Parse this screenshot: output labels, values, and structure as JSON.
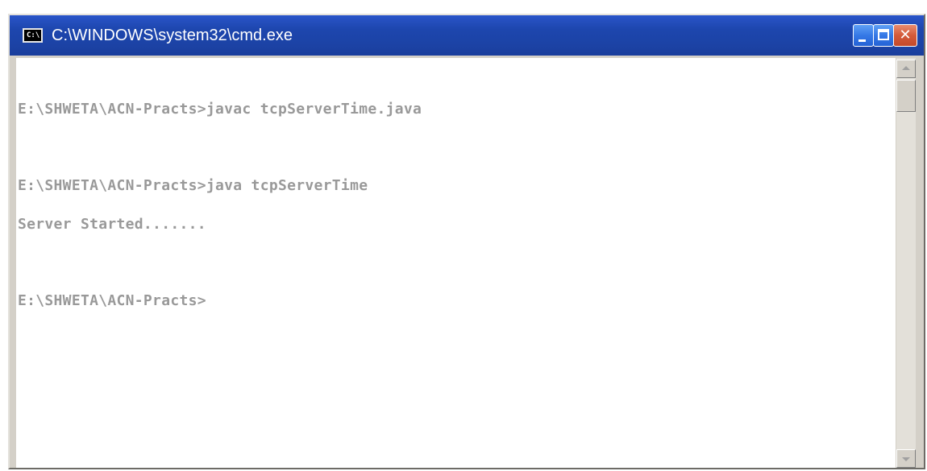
{
  "window": {
    "title": "C:\\WINDOWS\\system32\\cmd.exe",
    "icon_glyph": "C:\\"
  },
  "icons": {
    "app": "cmd-window-icon",
    "minimize": "minimize-icon",
    "maximize": "maximize-icon",
    "close": "close-icon",
    "scroll_up": "scroll-up-arrow-icon",
    "scroll_down": "scroll-down-arrow-icon"
  },
  "console": {
    "lines": [
      "E:\\SHWETA\\ACN-Practs>javac tcpServerTime.java",
      "",
      "E:\\SHWETA\\ACN-Practs>java tcpServerTime",
      "Server Started.......",
      "",
      "E:\\SHWETA\\ACN-Practs>"
    ]
  },
  "colors": {
    "titlebar": "#1d46ae",
    "console_background": "#ffffff",
    "console_text": "#999999",
    "close_button": "#d35a3a"
  }
}
